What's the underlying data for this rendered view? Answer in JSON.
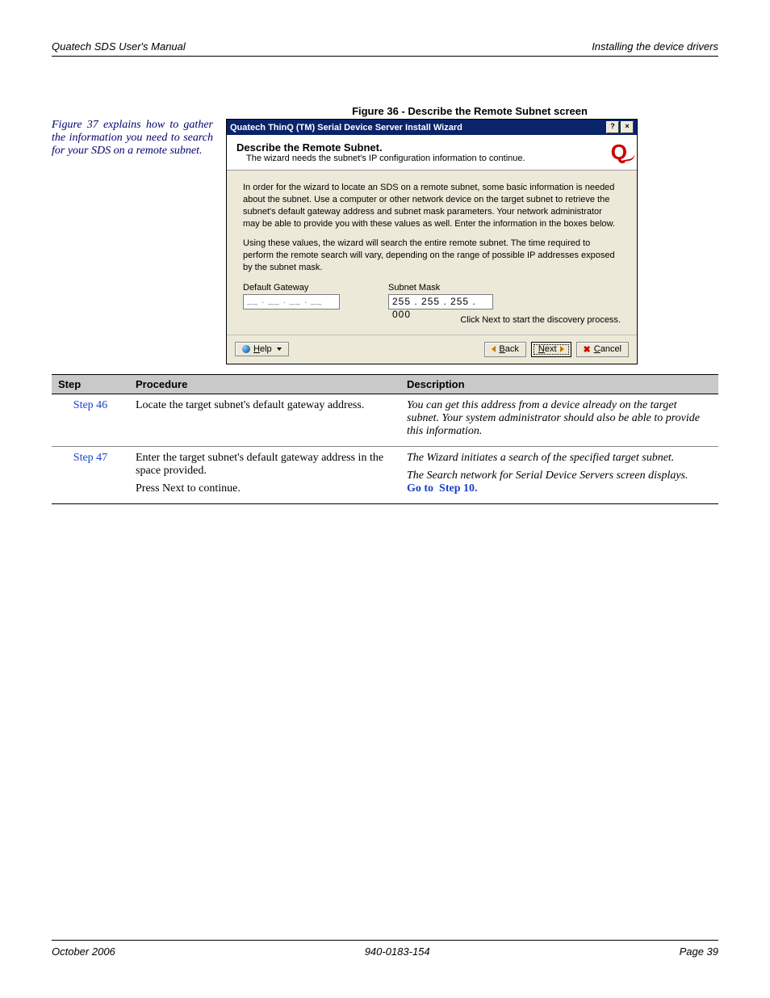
{
  "header": {
    "left": "Quatech SDS User's Manual",
    "right": "Installing the device drivers"
  },
  "figure_caption": "Figure 36 - Describe the Remote Subnet screen",
  "side_note": "Figure 37 explains how to gather the information you need to search for your SDS on a remote subnet.",
  "wizard": {
    "title": "Quatech ThinQ (TM) Serial Device Server Install Wizard",
    "help_btn": "?",
    "close_btn": "×",
    "head_title": "Describe the Remote Subnet.",
    "head_sub": "The wizard needs the subnet's IP configuration information to continue.",
    "body_p1": "In order for the wizard to locate an SDS on a remote subnet, some basic information is needed about the subnet. Use a computer or other network device on the target subnet to retrieve the subnet's default gateway address and subnet mask parameters. Your network administrator may be able to provide you with these values as well. Enter the information in the boxes below.",
    "body_p2": "Using these values, the wizard will search the entire remote subnet. The time required to perform the remote search will vary, depending on the range of possible IP addresses exposed by the subnet mask.",
    "gateway_label": "Default Gateway",
    "gateway_value": "__ . __ . __ . __",
    "mask_label": "Subnet Mask",
    "mask_value": "255 . 255 . 255 . 000",
    "tip": "Click Next to start the discovery process.",
    "help": "Help",
    "back": "Back",
    "next": "Next",
    "cancel": "Cancel"
  },
  "table": {
    "headers": {
      "step": "Step",
      "procedure": "Procedure",
      "description": "Description"
    },
    "rows": [
      {
        "step": "Step 46",
        "procedure": "Locate the target subnet's default gateway address.",
        "description": "You can get this address from a device already on the target subnet. Your system administrator should also be able to provide this information."
      },
      {
        "step": "Step 47",
        "procedure_line1": "Enter the target subnet's default gateway address in the space provided.",
        "procedure_line2": "Press Next to continue.",
        "description_line1": "The Wizard initiates a search of the specified target subnet.",
        "description_line2": "The Search network for Serial Device Servers screen displays.",
        "goto": "Go to ­ Step 10."
      }
    ]
  },
  "footer": {
    "left": "October 2006",
    "center": "940-0183-154",
    "right": "Page 39"
  }
}
